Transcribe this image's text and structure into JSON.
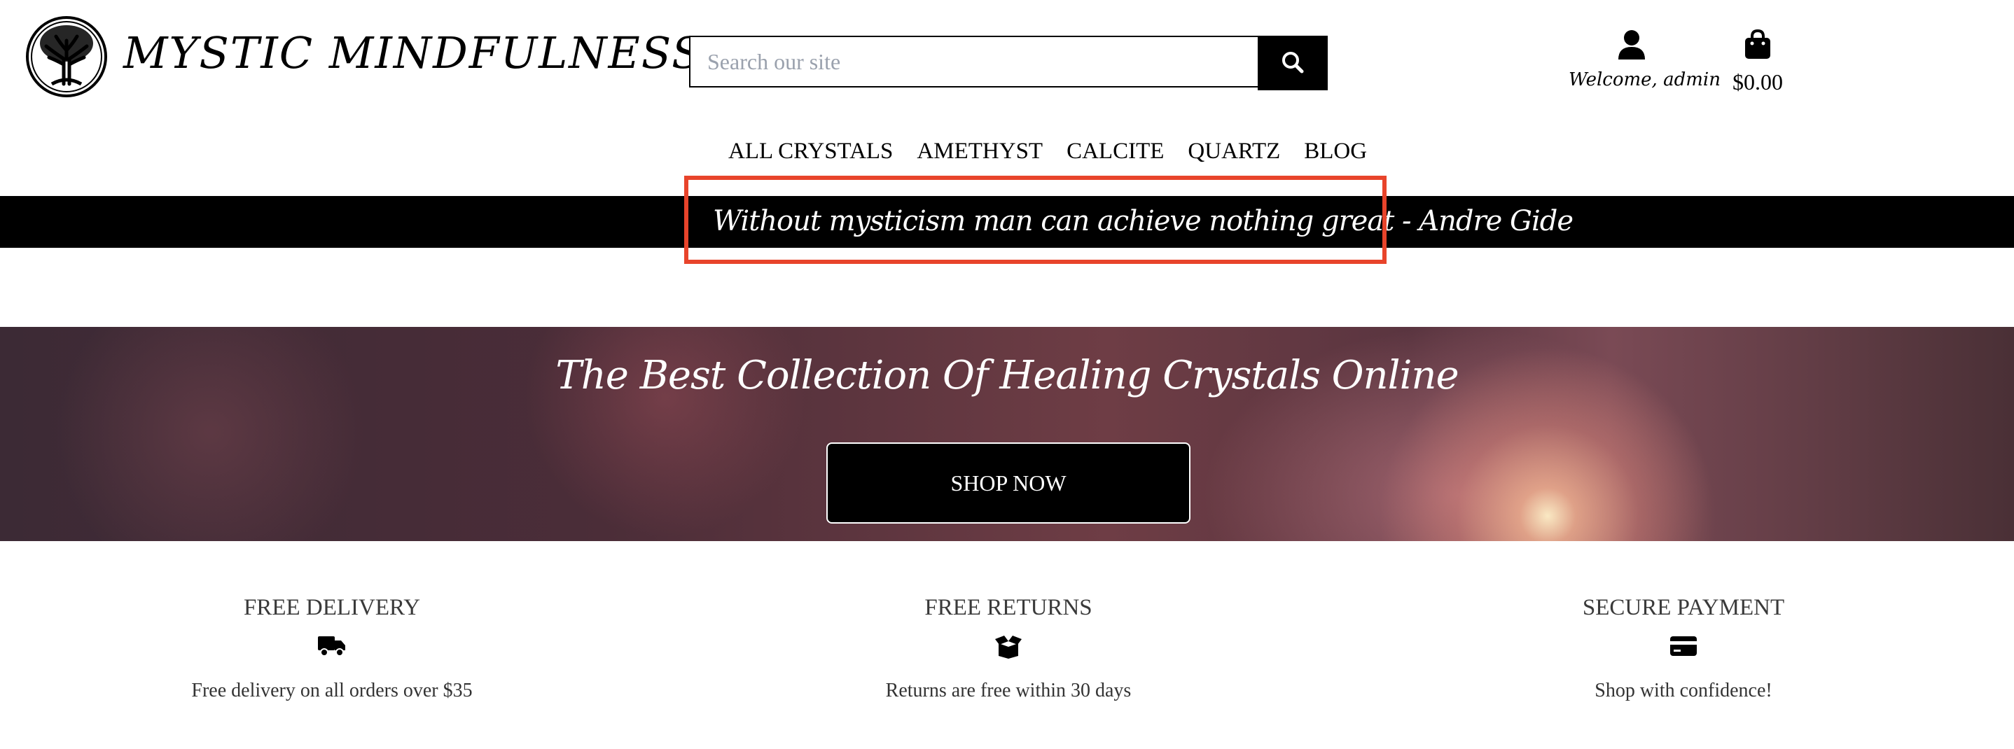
{
  "brand": {
    "name": "MYSTIC MINDFULNESS",
    "logo_icon": "tree-of-life-icon"
  },
  "search": {
    "placeholder": "Search our site",
    "value": "",
    "button_icon": "search-icon"
  },
  "account": {
    "icon": "user-icon",
    "label": "Welcome, admin"
  },
  "cart": {
    "icon": "shopping-bag-icon",
    "total": "$0.00"
  },
  "nav": {
    "items": [
      "ALL CRYSTALS",
      "AMETHYST",
      "CALCITE",
      "QUARTZ",
      "BLOG"
    ]
  },
  "quote": {
    "text": "Without mysticism man can achieve nothing great - Andre Gide",
    "highlight_color": "#e8442b"
  },
  "hero": {
    "title": "The Best Collection Of Healing Crystals Online",
    "cta_label": "SHOP NOW"
  },
  "features": [
    {
      "title": "FREE DELIVERY",
      "icon": "truck-icon",
      "text": "Free delivery on all orders over $35"
    },
    {
      "title": "FREE RETURNS",
      "icon": "box-open-icon",
      "text": "Returns are free within 30 days"
    },
    {
      "title": "SECURE PAYMENT",
      "icon": "credit-card-icon",
      "text": "Shop with confidence!"
    }
  ]
}
